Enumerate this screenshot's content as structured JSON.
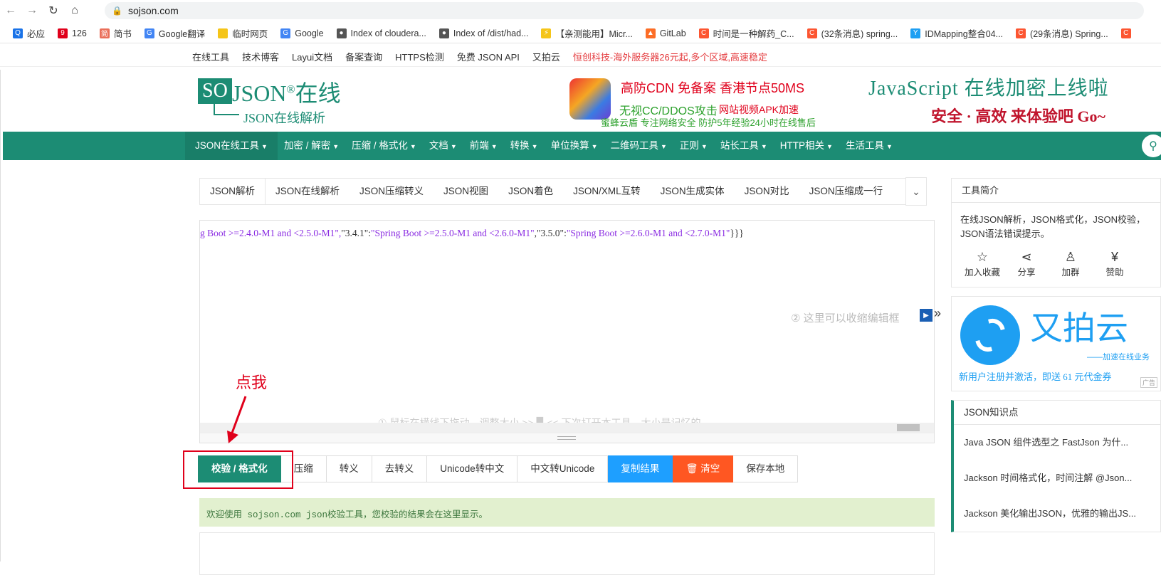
{
  "browser": {
    "url": "sojson.com",
    "bookmarks": [
      {
        "label": "必应",
        "icon": "search-icon",
        "color": "#1a73e8"
      },
      {
        "label": "126",
        "icon": "126-icon",
        "color": "#e0001b"
      },
      {
        "label": "简书",
        "icon": "jianshu-icon",
        "color": "#ea6f5a"
      },
      {
        "label": "Google翻译",
        "icon": "translate-icon",
        "color": "#4285f4"
      },
      {
        "label": "临时网页",
        "icon": "folder-icon",
        "color": "#f5c518"
      },
      {
        "label": "Google",
        "icon": "google-icon",
        "color": "#4285f4"
      },
      {
        "label": "Index of cloudera...",
        "icon": "globe-icon",
        "color": "#555555"
      },
      {
        "label": "Index of /dist/had...",
        "icon": "globe-icon",
        "color": "#555555"
      },
      {
        "label": "【亲测能用】Micr...",
        "icon": "bolt-icon",
        "color": "#f5c518"
      },
      {
        "label": "GitLab",
        "icon": "gitlab-icon",
        "color": "#fc6d26"
      },
      {
        "label": "时间是一种解药_C...",
        "icon": "csdn-icon",
        "color": "#fc5531"
      },
      {
        "label": "(32条消息) spring...",
        "icon": "csdn-icon",
        "color": "#fc5531"
      },
      {
        "label": "IDMapping整合04...",
        "icon": "y-icon",
        "color": "#1e9ff2"
      },
      {
        "label": "(29条消息) Spring...",
        "icon": "csdn-icon",
        "color": "#fc5531"
      },
      {
        "label": "",
        "icon": "csdn-icon",
        "color": "#fc5531"
      }
    ]
  },
  "topnav": {
    "links": [
      "在线工具",
      "技术博客",
      "Layui文档",
      "备案查询",
      "HTTPS检测",
      "免费 JSON API",
      "又拍云"
    ],
    "promo": "恒创科技-海外服务器26元起,多个区域,高速稳定"
  },
  "logo": {
    "so": "SO",
    "json": "JSON",
    "reg": "®",
    "online": "在线",
    "sub": "JSON在线解析"
  },
  "ad_center": {
    "line1": "高防CDN  免备案  香港节点50MS",
    "line2": "无视CC/DDOS攻击",
    "line2b": "网站视频APK加速",
    "line3": "蜜蜂云盾  专注网络安全  防护5年经验24小时在线售后"
  },
  "ad_right": {
    "title": "JavaScript 在线加密上线啦",
    "subtitle": "安全 · 高效  来体验吧  Go~"
  },
  "mainnav": {
    "items": [
      "JSON在线工具",
      "加密 / 解密",
      "压缩 / 格式化",
      "文档",
      "前端",
      "转换",
      "单位换算",
      "二维码工具",
      "正则",
      "站长工具",
      "HTTP相关",
      "生活工具"
    ],
    "active_index": 0
  },
  "tabs": [
    "JSON解析",
    "JSON在线解析",
    "JSON压缩转义",
    "JSON视图",
    "JSON着色",
    "JSON/XML互转",
    "JSON生成实体",
    "JSON对比",
    "JSON压缩成一行"
  ],
  "editor": {
    "code_prefix": "g Boot >=2.4.0-M1 and <2.5.0-M1\",",
    "code_segments": [
      {
        "k": "\"3.4.1\"",
        "v": "\"Spring Boot >=2.5.0-M1 and <2.6.0-M1\""
      },
      {
        "k": "\"3.5.0\"",
        "v": "\"Spring Boot >=2.6.0-M1 and <2.7.0-M1\""
      }
    ],
    "code_suffix": "}}}",
    "hint_collapse": "②  这里可以收缩编辑框",
    "hint_resize": "①  鼠标在横线下拖动，调整大小 >> ▉ << 下次打开本工具，大小是记忆的"
  },
  "annotation": {
    "text": "点我"
  },
  "buttons": [
    {
      "label": "校验 / 格式化",
      "style": "primary"
    },
    {
      "label": "压缩",
      "style": "default"
    },
    {
      "label": "转义",
      "style": "default"
    },
    {
      "label": "去转义",
      "style": "default"
    },
    {
      "label": "Unicode转中文",
      "style": "default"
    },
    {
      "label": "中文转Unicode",
      "style": "default"
    },
    {
      "label": "复制结果",
      "style": "blue"
    },
    {
      "label": "清空",
      "style": "orange"
    },
    {
      "label": "保存本地",
      "style": "default"
    }
  ],
  "result": {
    "message": "欢迎使用 sojson.com json校验工具，您校验的结果会在这里显示。"
  },
  "sidebar": {
    "intro_title": "工具简介",
    "intro_text": "在线JSON解析，JSON格式化，JSON校验，JSON语法错误提示。",
    "actions": [
      {
        "label": "加入收藏",
        "icon": "star-icon"
      },
      {
        "label": "分享",
        "icon": "share-icon"
      },
      {
        "label": "加群",
        "icon": "qq-icon"
      },
      {
        "label": "赞助",
        "icon": "yen-icon"
      }
    ],
    "ad": {
      "brand": "又拍云",
      "tagline": "——加速在线业务",
      "promo": "新用户注册并激活，即送 61 元代金券",
      "badge": "广告"
    },
    "knowledge_title": "JSON知识点",
    "knowledge_items": [
      "Java JSON 组件选型之 FastJson 为什...",
      "Jackson 时间格式化，时间注解 @Json...",
      "Jackson 美化输出JSON，优雅的输出JS..."
    ]
  },
  "colors": {
    "brand": "#1c8c74",
    "annotation": "#e0001b",
    "blue": "#1e9fff",
    "orange": "#ff5722"
  }
}
